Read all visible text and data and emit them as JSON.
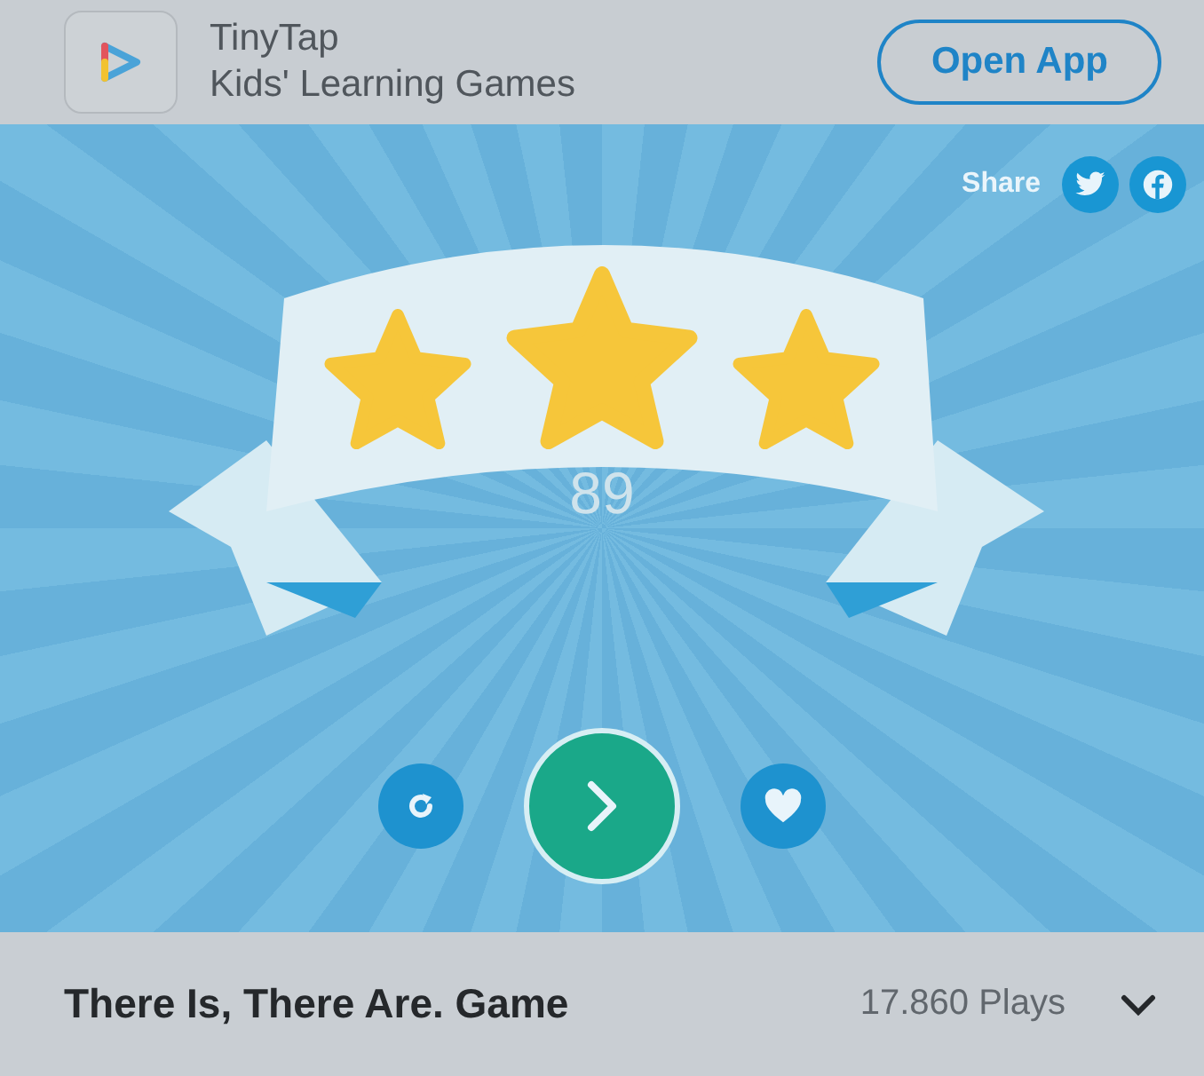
{
  "app_banner": {
    "app_name": "TinyTap",
    "subtitle": "Kids' Learning Games",
    "button": "Open App"
  },
  "game": {
    "share_label": "Share",
    "stars": 3,
    "score": "89"
  },
  "footer": {
    "title": "There Is, There Are. Game",
    "plays": "17.860 Plays"
  }
}
